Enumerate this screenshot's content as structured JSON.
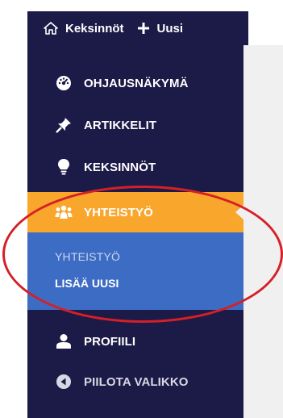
{
  "admin_bar": {
    "site_name": "Keksinnöt",
    "new_label": "Uusi"
  },
  "sidebar": {
    "items": [
      {
        "label": "OHJAUSNÄKYMÄ",
        "icon": "dashboard-gauge-icon"
      },
      {
        "label": "ARTIKKELIT",
        "icon": "pushpin-icon"
      },
      {
        "label": "KEKSINNÖT",
        "icon": "lightbulb-icon"
      },
      {
        "label": "YHTEISTYÖ",
        "icon": "group-people-icon",
        "active": true
      },
      {
        "label": "PROFIILI",
        "icon": "user-icon"
      },
      {
        "label": "PIILOTA VALIKKO",
        "icon": "collapse-arrow-icon"
      }
    ],
    "submenu": [
      {
        "label": "YHTEISTYÖ"
      },
      {
        "label": "LISÄÄ UUSI"
      }
    ]
  },
  "colors": {
    "sidebar_bg": "#1c1a47",
    "active_item_bg": "#f9a62c",
    "submenu_bg": "#3d6cc4",
    "highlight_ring": "#d42026"
  }
}
